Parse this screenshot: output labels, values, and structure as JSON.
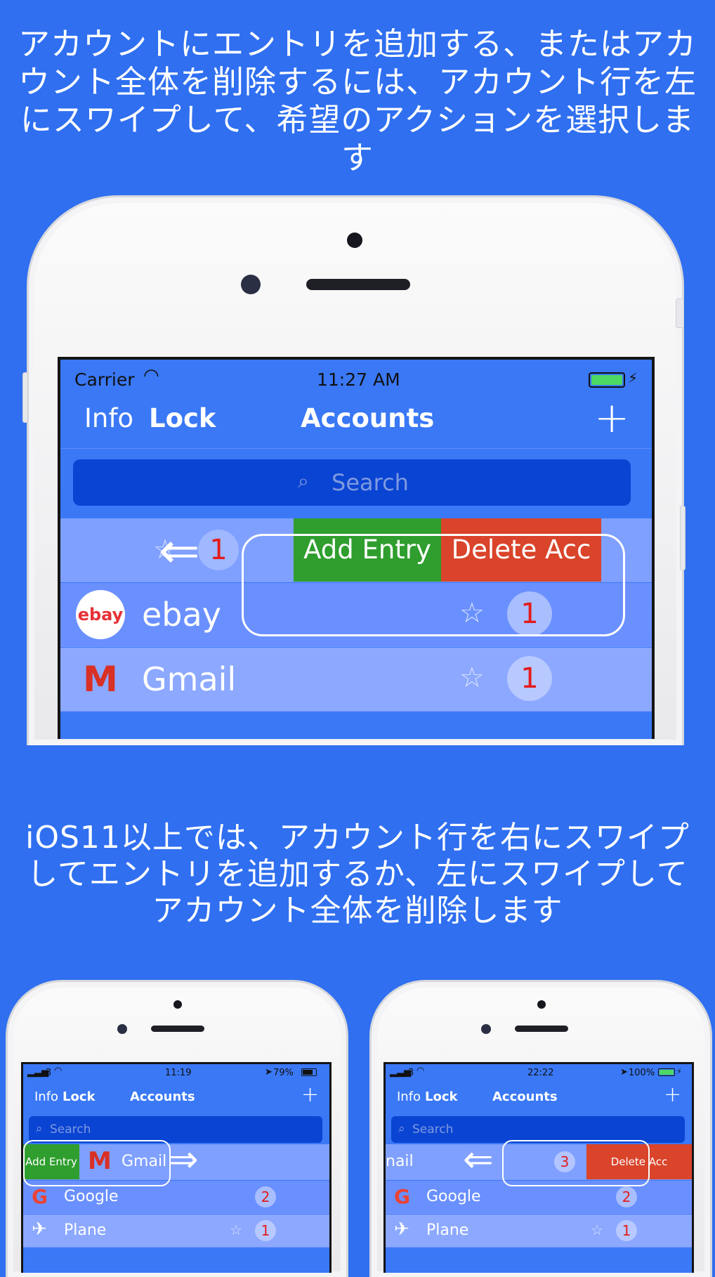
{
  "captions": {
    "top": "アカウントにエントリを追加する、またはアカウント全体を削除するには、アカウント行を左にスワイプして、希望のアクションを選択します",
    "middle": "iOS11以上では、アカウント行を右にスワイプしてエントリを追加するか、左にスワイプしてアカウント全体を削除します"
  },
  "phone_main": {
    "status": {
      "carrier": "Carrier",
      "time": "11:27 AM"
    },
    "nav": {
      "info": "Info",
      "lock": "Lock",
      "title": "Accounts",
      "add": "+"
    },
    "search_placeholder": "Search",
    "swiped_row": {
      "count": "1",
      "add_entry": "Add Entry",
      "delete": "Delete Acc"
    },
    "rows": [
      {
        "name": "ebay",
        "count": "1",
        "logo": "ebay"
      },
      {
        "name": "Gmail",
        "count": "1",
        "logo": "M"
      }
    ]
  },
  "phone_left": {
    "status": {
      "signal": "3",
      "time": "11:19",
      "battery": "79%"
    },
    "nav": {
      "info": "Info",
      "lock": "Lock",
      "title": "Accounts",
      "add": "+"
    },
    "search_placeholder": "Search",
    "swiped_row": {
      "add_entry": "Add Entry",
      "name": "Gmail"
    },
    "rows": [
      {
        "name": "Google",
        "count": "2"
      },
      {
        "name": "Plane",
        "count": "1"
      }
    ]
  },
  "phone_right": {
    "status": {
      "signal": "3",
      "time": "22:22",
      "battery": "100%"
    },
    "nav": {
      "info": "Info",
      "lock": "Lock",
      "title": "Accounts",
      "add": "+"
    },
    "search_placeholder": "Search",
    "swiped_row": {
      "name": "nail",
      "count": "3",
      "delete": "Delete Acc"
    },
    "rows": [
      {
        "name": "Google",
        "count": "2"
      },
      {
        "name": "Plane",
        "count": "1"
      }
    ]
  }
}
